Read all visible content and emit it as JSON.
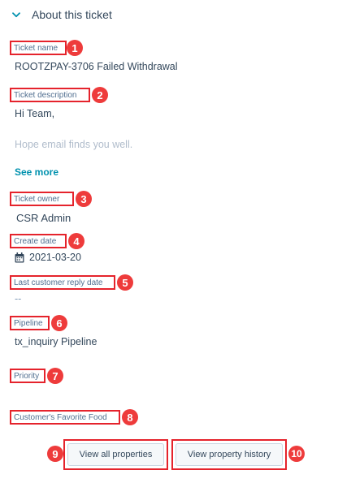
{
  "section": {
    "title": "About this ticket",
    "icon": "chevron-down-icon"
  },
  "fields": {
    "ticket_name": {
      "label": "Ticket name",
      "badge": "1",
      "value": "ROOTZPAY-3706 Failed Withdrawal"
    },
    "ticket_description": {
      "label": "Ticket description",
      "badge": "2",
      "line1": "Hi Team,",
      "line2": "Hope email finds you well.",
      "see_more": "See more"
    },
    "ticket_owner": {
      "label": "Ticket owner",
      "badge": "3",
      "value": "CSR Admin"
    },
    "create_date": {
      "label": "Create date",
      "badge": "4",
      "value": "2021-03-20",
      "icon": "calendar-icon"
    },
    "last_customer_reply_date": {
      "label": "Last customer reply date",
      "badge": "5",
      "value": "--"
    },
    "pipeline": {
      "label": "Pipeline",
      "badge": "6",
      "value": "tx_inquiry Pipeline"
    },
    "priority": {
      "label": "Priority",
      "badge": "7"
    },
    "favorite_food": {
      "label": "Customer's Favorite Food",
      "badge": "8"
    }
  },
  "buttons": {
    "view_all": {
      "label": "View all properties",
      "badge": "9"
    },
    "view_history": {
      "label": "View property history",
      "badge": "10"
    }
  },
  "colors": {
    "annotation_red": "#e5232c",
    "badge_red": "#ee3b3b",
    "link_teal": "#0091ae",
    "text": "#33475b",
    "label_text": "#516f90",
    "faded_text": "#b0bccb"
  }
}
